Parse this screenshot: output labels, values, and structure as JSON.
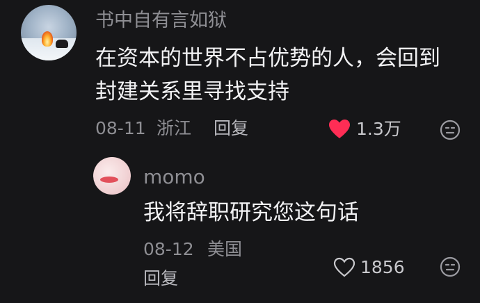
{
  "comment": {
    "username": "书中自有言如狱",
    "text_line1": "在资本的世界不占优势的人，会回到",
    "text_line2": "封建关系里寻找支持",
    "date": "08-11",
    "location": "浙江",
    "reply_label": "回复",
    "like_count": "1.3万",
    "liked": true,
    "like_color": "#ff2d55"
  },
  "reply": {
    "username": "momo",
    "text": "我将辞职研究您这句话",
    "date": "08-12",
    "location": "美国",
    "reply_label": "回复",
    "like_count": "1856",
    "liked": false
  },
  "icons": {
    "heart_filled": "heart-icon",
    "heart_outline": "heart-outline-icon",
    "dislike": "dislike-face-icon"
  }
}
